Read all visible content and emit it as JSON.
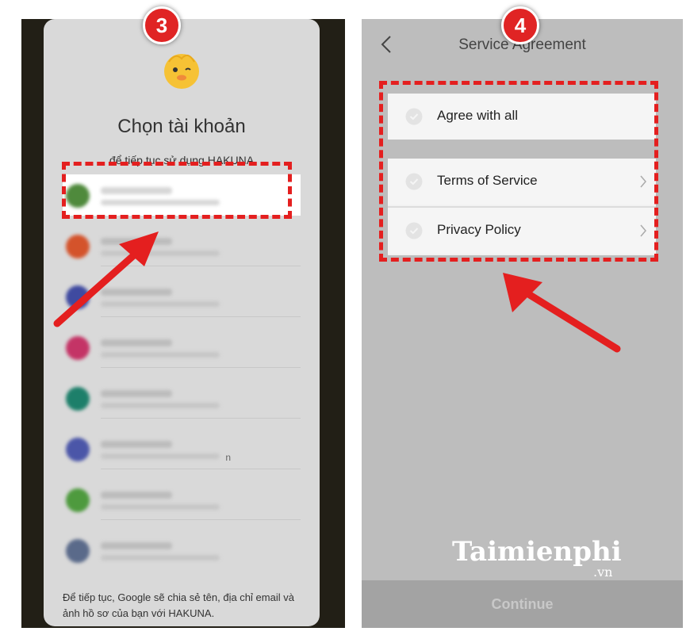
{
  "colors": {
    "accent": "#e41f1f",
    "highlight_row": "#ffffff",
    "continue_bg": "#a3a3a3"
  },
  "steps": {
    "left": "3",
    "right": "4"
  },
  "account_chooser": {
    "title": "Chọn tài khoản",
    "subtitle": "để tiếp tục sử dụng HAKUNA",
    "accounts": [
      {
        "avatar_color": "#4f8a3c",
        "trailing": ""
      },
      {
        "avatar_color": "#d4532b",
        "trailing": ""
      },
      {
        "avatar_color": "#3f4aa0",
        "trailing": ""
      },
      {
        "avatar_color": "#c43466",
        "trailing": ""
      },
      {
        "avatar_color": "#1d7f6a",
        "trailing": ""
      },
      {
        "avatar_color": "#4b56a8",
        "trailing": "n"
      },
      {
        "avatar_color": "#4e9a3e",
        "trailing": ""
      },
      {
        "avatar_color": "#5a6a8a",
        "trailing": ""
      }
    ],
    "footer": "Để tiếp tục, Google sẽ chia sẻ tên, địa chỉ email và ảnh hồ sơ của bạn với HAKUNA."
  },
  "service_agreement": {
    "title": "Service Agreement",
    "back_icon": "chevron-left-icon",
    "agree_all": "Agree with all",
    "terms": "Terms of Service",
    "privacy": "Privacy Policy",
    "continue_label": "Continue"
  },
  "watermark": {
    "main": "Taimienphi",
    "sub": ".vn"
  }
}
